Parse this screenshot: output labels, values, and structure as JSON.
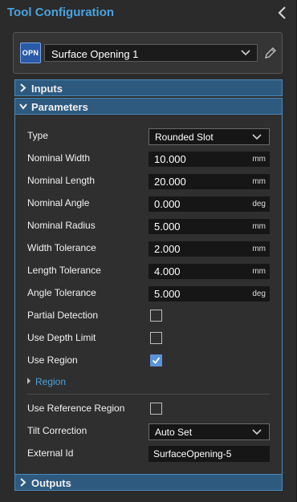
{
  "header": {
    "title": "Tool Configuration",
    "collapse_icon": "chevron-left-icon"
  },
  "tool": {
    "badge": "OPN",
    "name": "Surface Opening 1",
    "edit_icon": "pencil-icon"
  },
  "sections": {
    "inputs": "Inputs",
    "parameters": "Parameters",
    "outputs": "Outputs"
  },
  "params": {
    "type": {
      "label": "Type",
      "value": "Rounded Slot"
    },
    "nominal_width": {
      "label": "Nominal Width",
      "value": "10.000",
      "unit": "mm"
    },
    "nominal_length": {
      "label": "Nominal Length",
      "value": "20.000",
      "unit": "mm"
    },
    "nominal_angle": {
      "label": "Nominal Angle",
      "value": "0.000",
      "unit": "deg"
    },
    "nominal_radius": {
      "label": "Nominal Radius",
      "value": "5.000",
      "unit": "mm"
    },
    "width_tolerance": {
      "label": "Width Tolerance",
      "value": "2.000",
      "unit": "mm"
    },
    "length_tolerance": {
      "label": "Length Tolerance",
      "value": "4.000",
      "unit": "mm"
    },
    "angle_tolerance": {
      "label": "Angle Tolerance",
      "value": "5.000",
      "unit": "deg"
    },
    "partial_detection": {
      "label": "Partial Detection",
      "checked": false
    },
    "use_depth_limit": {
      "label": "Use Depth Limit",
      "checked": false
    },
    "use_region": {
      "label": "Use Region",
      "checked": true
    },
    "region": {
      "label": "Region"
    },
    "use_reference_region": {
      "label": "Use Reference Region",
      "checked": false
    },
    "tilt_correction": {
      "label": "Tilt Correction",
      "value": "Auto Set"
    },
    "external_id": {
      "label": "External Id",
      "value": "SurfaceOpening-5"
    }
  },
  "colors": {
    "accent": "#4aa3df",
    "section_header": "#2e5a80",
    "checkbox_on": "#5a93d8"
  }
}
